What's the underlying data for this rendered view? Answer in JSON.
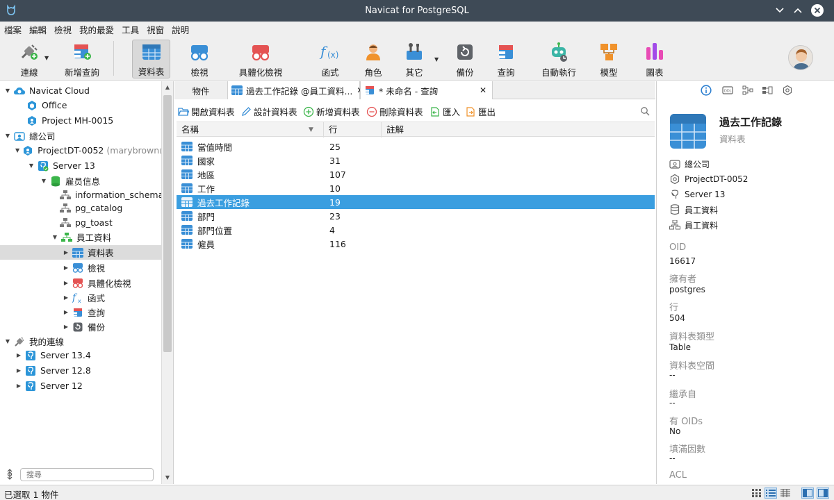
{
  "window": {
    "title": "Navicat for PostgreSQL"
  },
  "menu": [
    "檔案",
    "編輯",
    "檢視",
    "我的最愛",
    "工具",
    "視窗",
    "說明"
  ],
  "toolbar": {
    "connect": "連線",
    "new_query": "新增查詢",
    "tables": "資料表",
    "views": "檢視",
    "mat_views": "具體化檢視",
    "functions": "函式",
    "roles": "角色",
    "others": "其它",
    "backup": "備份",
    "query": "查詢",
    "automation": "自動執行",
    "model": "模型",
    "charts": "圖表"
  },
  "tree": {
    "navicat_cloud": "Navicat Cloud",
    "office": "Office",
    "project_mh": "Project MH-0015",
    "hq": "總公司",
    "project_dt": "ProjectDT-0052",
    "project_dt_owner": "(marybrown@",
    "server13": "Server 13",
    "employee_info_db": "雇员信息",
    "schema_info": "information_schema",
    "schema_catalog": "pg_catalog",
    "schema_toast": "pg_toast",
    "schema_emp": "員工資料",
    "node_tables": "資料表",
    "node_views": "檢視",
    "node_matviews": "具體化檢視",
    "node_functions": "函式",
    "node_queries": "查詢",
    "node_backups": "備份",
    "my_connections": "我的連線",
    "server134": "Server 13.4",
    "server128": "Server 12.8",
    "server12": "Server 12"
  },
  "search": {
    "placeholder": "搜尋"
  },
  "tabs": {
    "objects": "物件",
    "table_tab": "過去工作記錄 @員工資料...",
    "query_tab": "* 未命名 - 查詢"
  },
  "object_actions": {
    "open": "開啟資料表",
    "design": "設計資料表",
    "new": "新增資料表",
    "delete": "刪除資料表",
    "import": "匯入",
    "export": "匯出"
  },
  "table": {
    "columns": [
      "名稱",
      "行",
      "註解"
    ],
    "rows": [
      {
        "name": "當值時間",
        "rows": "25"
      },
      {
        "name": "國家",
        "rows": "31"
      },
      {
        "name": "地區",
        "rows": "107"
      },
      {
        "name": "工作",
        "rows": "10"
      },
      {
        "name": "過去工作記錄",
        "rows": "19"
      },
      {
        "name": "部門",
        "rows": "23"
      },
      {
        "name": "部門位置",
        "rows": "4"
      },
      {
        "name": "僱員",
        "rows": "116"
      }
    ]
  },
  "info": {
    "title": "過去工作記錄",
    "subtitle": "資料表",
    "path": [
      "總公司",
      "ProjectDT-0052",
      "Server 13",
      "員工資料",
      "員工資料"
    ],
    "props": [
      {
        "key": "OID",
        "value": "16617"
      },
      {
        "key": "擁有者",
        "value": "postgres"
      },
      {
        "key": "行",
        "value": "504"
      },
      {
        "key": "資料表類型",
        "value": "Table"
      },
      {
        "key": "資料表空間",
        "value": "--"
      },
      {
        "key": "繼承自",
        "value": "--"
      },
      {
        "key": "有 OIDs",
        "value": "No"
      },
      {
        "key": "填滿因數",
        "value": "--"
      },
      {
        "key": "ACL",
        "value": ""
      }
    ]
  },
  "status": {
    "text": "已選取 1 物件"
  },
  "colors": {
    "accent": "#3a9ee0",
    "titlebar": "#3e4a56",
    "selected_row": "#3a9ee0"
  }
}
